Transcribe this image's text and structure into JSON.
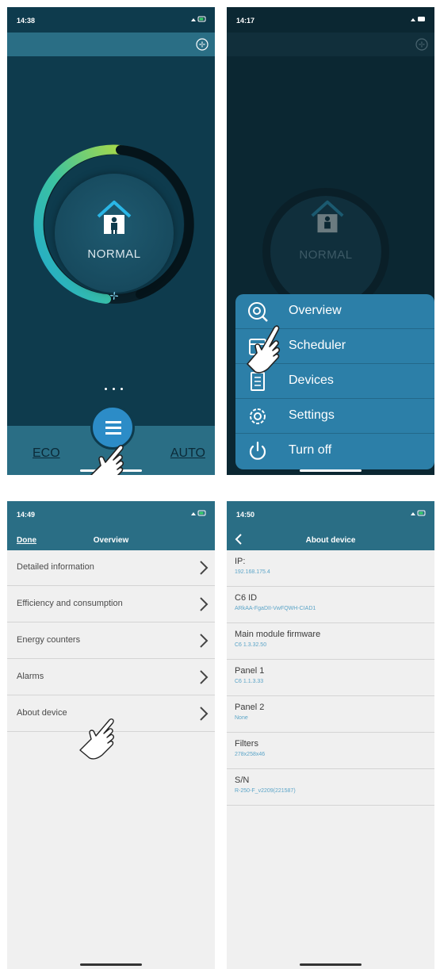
{
  "screen1": {
    "time": "14:38",
    "mode": "NORMAL",
    "eco_label": "ECO",
    "auto_label": "AUTO",
    "gauge_level": 0.6,
    "colors": {
      "bg": "#0e3b4d",
      "bar": "#2a6e85",
      "accent": "#2c8cc7",
      "gauge_start": "#23b4d6",
      "gauge_end": "#a6d94a"
    }
  },
  "screen2": {
    "time": "14:17",
    "mode": "NORMAL",
    "menu": [
      {
        "label": "Overview",
        "icon": "overview-icon"
      },
      {
        "label": "Scheduler",
        "icon": "scheduler-icon"
      },
      {
        "label": "Devices",
        "icon": "devices-icon"
      },
      {
        "label": "Settings",
        "icon": "settings-icon"
      },
      {
        "label": "Turn off",
        "icon": "power-icon"
      }
    ]
  },
  "screen3": {
    "time": "14:49",
    "done_label": "Done",
    "title": "Overview",
    "items": [
      "Detailed information",
      "Efficiency and consumption",
      "Energy counters",
      "Alarms",
      "About device"
    ]
  },
  "screen4": {
    "time": "14:50",
    "title": "About device",
    "fields": [
      {
        "key": "IP:",
        "value": "192.168.175.4"
      },
      {
        "key": "C6 ID",
        "value": "ARkAA-FgaDII-VwFQWH-CIAD1"
      },
      {
        "key": "Main module firmware",
        "value": "C6 1.3.32.50"
      },
      {
        "key": "Panel 1",
        "value": "C6 1.1.3.33"
      },
      {
        "key": "Panel 2",
        "value": "None"
      },
      {
        "key": "Filters",
        "value": "278x258x46"
      },
      {
        "key": "S/N",
        "value": "R-250-F_v2209(221587)"
      }
    ]
  }
}
